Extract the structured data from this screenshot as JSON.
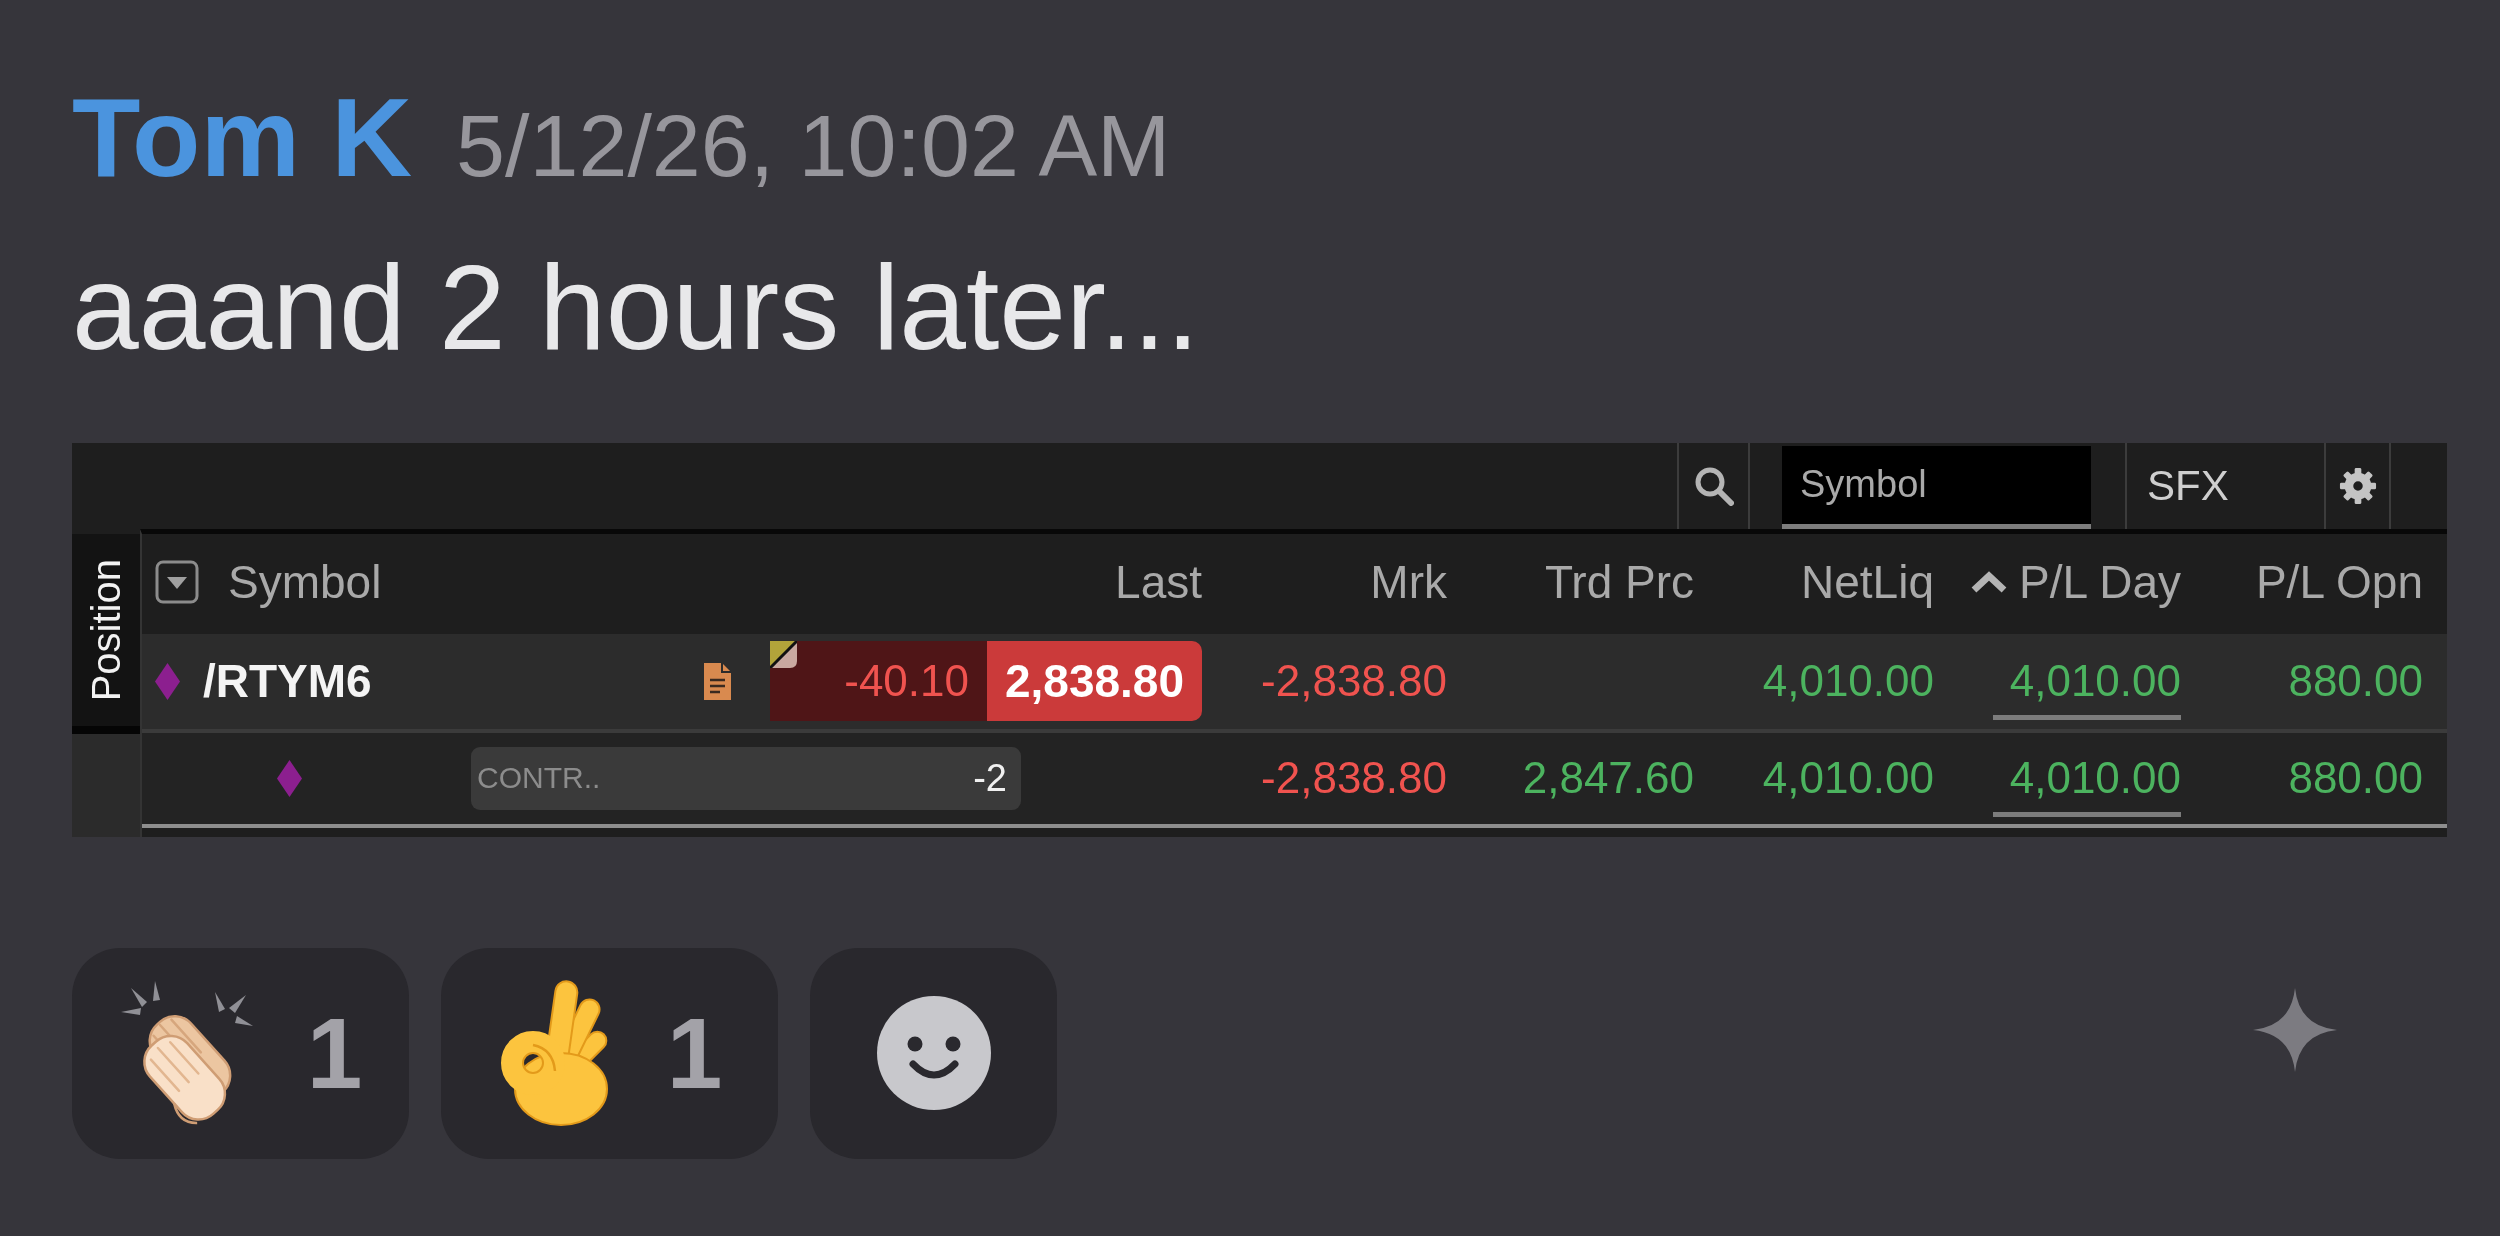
{
  "message": {
    "author": "Tom K",
    "timestamp": "5/12/26, 10:02 AM",
    "text": "aaand 2 hours later..."
  },
  "attachment": {
    "toolbar": {
      "symbol_field": {
        "placeholder": "Symbol"
      },
      "account": "SFX"
    },
    "side_tab": {
      "label": "Position",
      "selected": true
    },
    "table": {
      "columns": [
        {
          "label": "Symbol",
          "sorted": false
        },
        {
          "label": "Last",
          "sorted": false
        },
        {
          "label": "Mrk",
          "sorted": false
        },
        {
          "label": "Trd Prc",
          "sorted": false
        },
        {
          "label": "NetLiq",
          "sorted": false
        },
        {
          "label": "P/L Day",
          "sorted": true
        },
        {
          "label": "P/L Opn",
          "sorted": false
        }
      ],
      "rows": [
        {
          "kind": "position",
          "symbol": "/RTYM6",
          "has_note": true,
          "net_change": {
            "text": "-40.10",
            "negative": true
          },
          "last": {
            "text": "2,838.80",
            "negative": true
          },
          "mark": {
            "text": "-2,838.80",
            "negative": true
          },
          "net_liq": {
            "text": "4,010.00",
            "negative": false
          },
          "pl_day": {
            "text": "4,010.00",
            "negative": false
          },
          "pl_open": {
            "text": "880.00",
            "negative": false
          }
        },
        {
          "kind": "leg",
          "quantity_label": "CONTR..",
          "quantity": "-2",
          "mark": {
            "text": "-2,838.80",
            "negative": true
          },
          "trade_price": {
            "text": "2,847.60",
            "negative": false
          },
          "net_liq": {
            "text": "4,010.00",
            "negative": false
          },
          "pl_day": {
            "text": "4,010.00",
            "negative": false
          },
          "pl_open": {
            "text": "880.00",
            "negative": false
          }
        }
      ]
    }
  },
  "reactions": [
    {
      "kind": "clap",
      "count": "1",
      "selected": false
    },
    {
      "kind": "ok_hand",
      "count": "1",
      "selected": false
    }
  ]
}
